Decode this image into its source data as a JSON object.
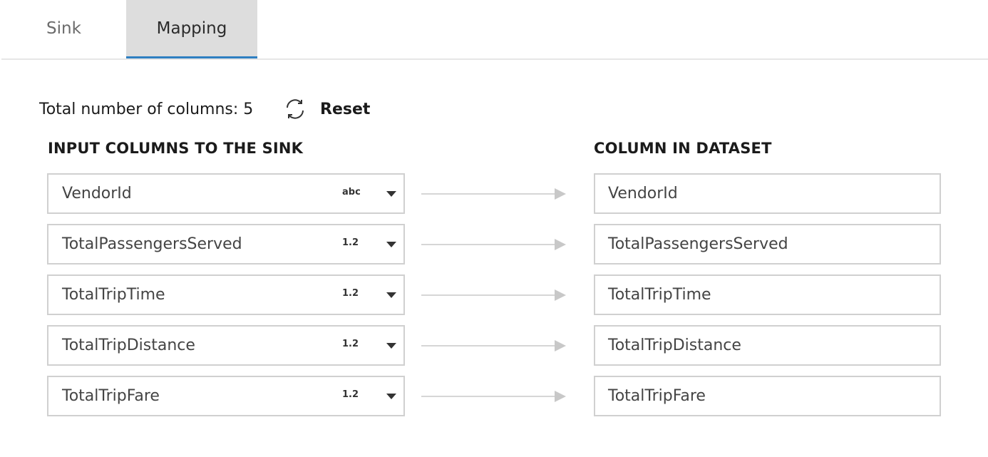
{
  "tabs": {
    "sink": "Sink",
    "mapping": "Mapping"
  },
  "summary": {
    "label": "Total number of columns: 5",
    "reset_label": "Reset"
  },
  "headers": {
    "input": "INPUT COLUMNS TO THE SINK",
    "dataset": "COLUMN IN DATASET"
  },
  "rows": [
    {
      "input": "VendorId",
      "type": "abc",
      "dataset": "VendorId"
    },
    {
      "input": "TotalPassengersServed",
      "type": "1.2",
      "dataset": "TotalPassengersServed"
    },
    {
      "input": "TotalTripTime",
      "type": "1.2",
      "dataset": "TotalTripTime"
    },
    {
      "input": "TotalTripDistance",
      "type": "1.2",
      "dataset": "TotalTripDistance"
    },
    {
      "input": "TotalTripFare",
      "type": "1.2",
      "dataset": "TotalTripFare"
    }
  ],
  "colors": {
    "active_tab_underline": "#2f7fc1",
    "active_tab_bg": "#dddddd",
    "field_border": "#d0d0d0",
    "arrow": "#c8c8c8"
  },
  "icons": {
    "reset": "refresh-icon",
    "dropdown": "chevron-down-icon",
    "mapping_arrow": "arrow-right-icon"
  }
}
